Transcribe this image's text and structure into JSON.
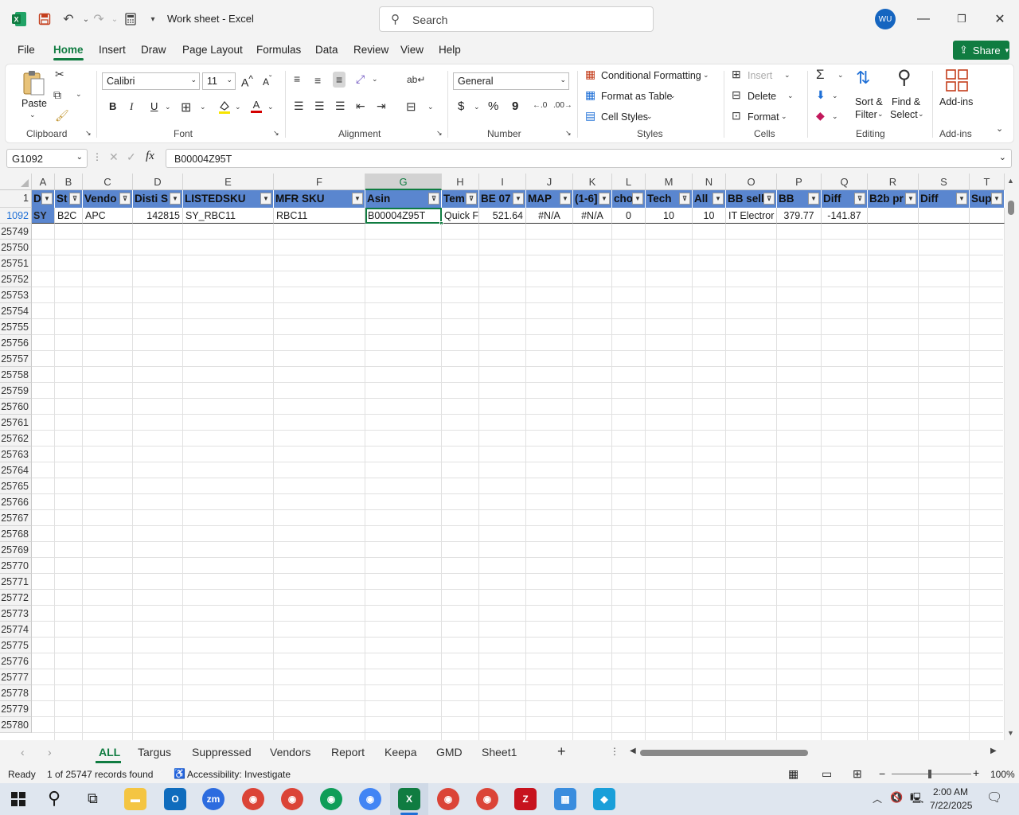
{
  "titlebar": {
    "title": "Work sheet  -  Excel",
    "search_placeholder": "Search",
    "avatar": "WU"
  },
  "menu": {
    "tabs": [
      "File",
      "Home",
      "Insert",
      "Draw",
      "Page Layout",
      "Formulas",
      "Data",
      "Review",
      "View",
      "Help"
    ],
    "share": "Share"
  },
  "ribbon": {
    "clipboard": {
      "paste": "Paste",
      "label": "Clipboard"
    },
    "font": {
      "name": "Calibri",
      "size": "11",
      "bold": "B",
      "italic": "I",
      "underline": "U",
      "label": "Font"
    },
    "alignment": {
      "label": "Alignment"
    },
    "number": {
      "format": "General",
      "currency": "$",
      "percent": "%",
      "comma": "9",
      "label": "Number"
    },
    "styles": {
      "conditional": "Conditional Formatting",
      "format_table": "Format as Table",
      "cell_styles": "Cell Styles",
      "label": "Styles"
    },
    "cells": {
      "insert": "Insert",
      "delete": "Delete",
      "format": "Format",
      "label": "Cells"
    },
    "editing": {
      "sort_filter_1": "Sort &",
      "sort_filter_2": "Filter",
      "find_select_1": "Find &",
      "find_select_2": "Select",
      "label": "Editing"
    },
    "addins": {
      "button": "Add-ins",
      "label": "Add-ins"
    }
  },
  "formula": {
    "namebox": "G1092",
    "value": "B00004Z95T"
  },
  "grid": {
    "columns": [
      "A",
      "B",
      "C",
      "D",
      "E",
      "F",
      "G",
      "H",
      "I",
      "J",
      "K",
      "L",
      "M",
      "N",
      "O",
      "P",
      "Q",
      "R",
      "S",
      "T"
    ],
    "headers": [
      "D",
      "St",
      "Vendo",
      "Disti S",
      "LISTEDSKU",
      "MFR SKU",
      "Asin",
      "Tem",
      "BE 07",
      "MAP",
      "(1-6]",
      "cho",
      "Tech",
      "All",
      "BB sell",
      "BB",
      "Diff",
      "B2b pr",
      "Diff",
      "Sup"
    ],
    "header_row_num": "1",
    "data_row_num": "1092",
    "data_row": [
      "SY",
      "B2C",
      "APC",
      "142815",
      "SY_RBC11",
      "RBC11",
      "B00004Z95T",
      "Quick F",
      "521.64",
      "#N/A",
      "#N/A",
      "0",
      "10",
      "10",
      "IT Electror",
      "379.77",
      "-141.87",
      "",
      "",
      ""
    ],
    "row_numbers": [
      "25749",
      "25750",
      "25751",
      "25752",
      "25753",
      "25754",
      "25755",
      "25756",
      "25757",
      "25758",
      "25759",
      "25760",
      "25761",
      "25762",
      "25763",
      "25764",
      "25765",
      "25766",
      "25767",
      "25768",
      "25769",
      "25770",
      "25771",
      "25772",
      "25773",
      "25774",
      "25775",
      "25776",
      "25777",
      "25778",
      "25779",
      "25780"
    ]
  },
  "sheets": {
    "tabs": [
      "ALL",
      "Targus",
      "Suppressed",
      "Vendors",
      "Report",
      "Keepa",
      "GMD",
      "Sheet1"
    ],
    "add": "+"
  },
  "status": {
    "ready": "Ready",
    "records": "1 of 25747 records found",
    "accessibility": "Accessibility: Investigate",
    "zoom": "100%"
  },
  "taskbar": {
    "time": "2:00 AM",
    "date": "7/22/2025"
  }
}
